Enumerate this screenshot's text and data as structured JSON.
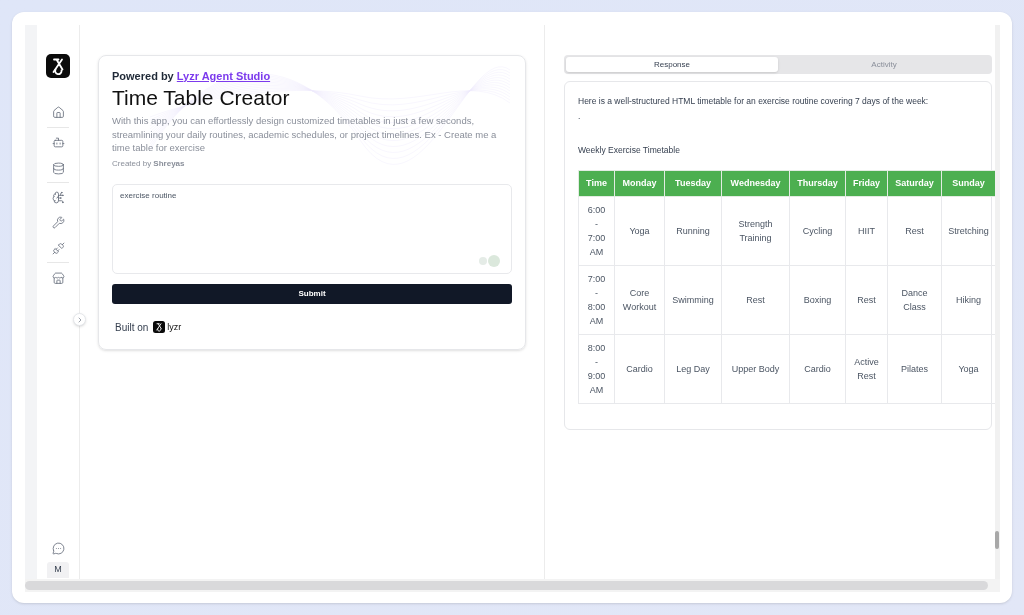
{
  "sidebar": {
    "avatar": "M"
  },
  "app_card": {
    "powered_by": "Powered by",
    "studio_link": "Lyzr Agent Studio",
    "title": "Time Table Creator",
    "description": "With this app, you can effortlessly design customized timetables in just a few seconds, streamlining your daily routines, academic schedules, or project timelines. Ex - Create me a time table for exercise",
    "created_by": "Created by **Shreyas**",
    "prompt_input": {
      "value": "exercise routine"
    },
    "submit_button": "Submit",
    "built_on": "Built on",
    "logo_wordmark": "lyzr"
  },
  "tabs": [
    {
      "label": "Response",
      "selected": true
    },
    {
      "label": "Activity",
      "selected": false
    }
  ],
  "response": {
    "intro": "Here is a well-structured HTML timetable for an exercise routine covering 7 days of the week:",
    "bullet": ".",
    "table_title": "Weekly Exercise Timetable",
    "table": {
      "columns": [
        "Time",
        "Monday",
        "Tuesday",
        "Wednesday",
        "Thursday",
        "Friday",
        "Saturday",
        "Sunday"
      ],
      "rows": [
        [
          "6:00 - 7:00 AM",
          "Yoga",
          "Running",
          "Strength Training",
          "Cycling",
          "HIIT",
          "Rest",
          "Stretching"
        ],
        [
          "7:00 - 8:00 AM",
          "Core Workout",
          "Swimming",
          "Rest",
          "Boxing",
          "Rest",
          "Dance Class",
          "Hiking"
        ],
        [
          "8:00 - 9:00 AM",
          "Cardio",
          "Leg Day",
          "Upper Body",
          "Cardio",
          "Active Rest",
          "Pilates",
          "Yoga"
        ]
      ]
    }
  }
}
